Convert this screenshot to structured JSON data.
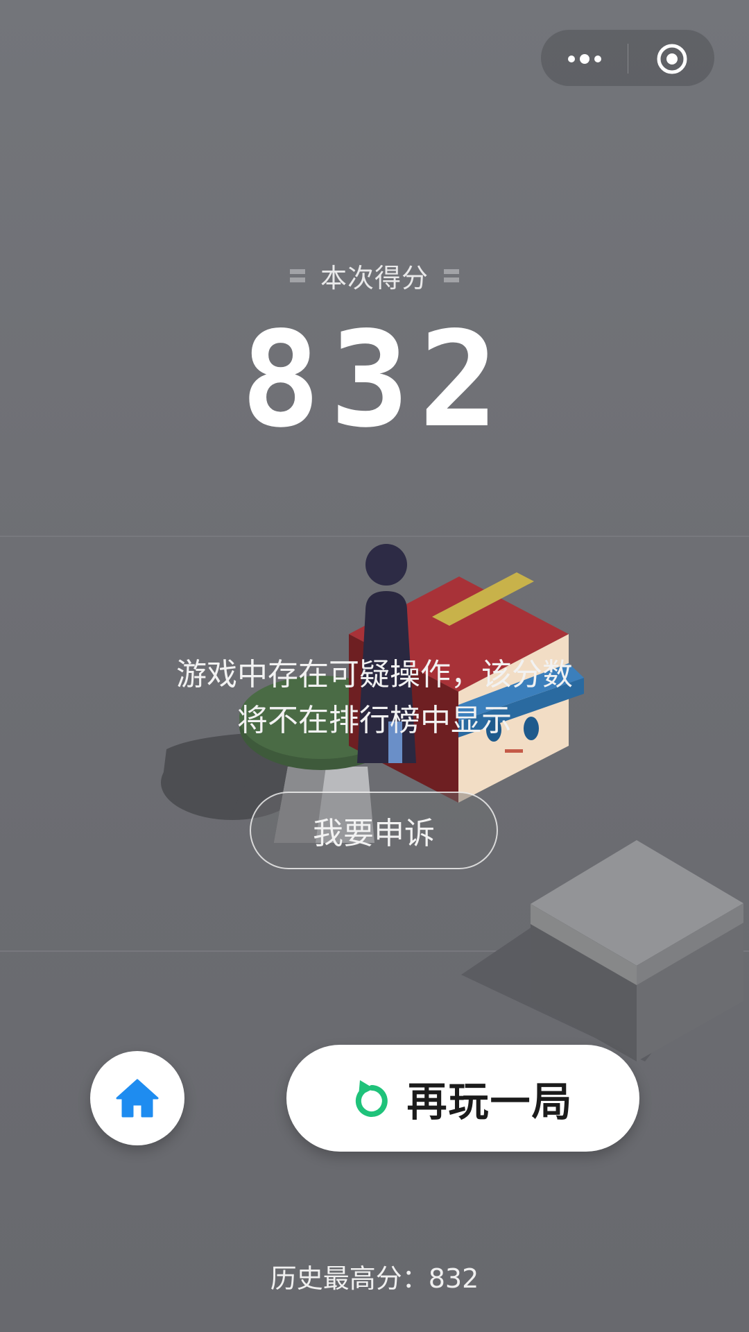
{
  "capsule": {
    "more_icon": "more-dots-icon",
    "close_icon": "target-close-icon"
  },
  "score": {
    "label": "本次得分",
    "value": "832"
  },
  "warning": {
    "line1": "游戏中存在可疑操作，该分数",
    "line2": "将不在排行榜中显示"
  },
  "appeal_button": {
    "label": "我要申诉"
  },
  "actions": {
    "home_icon": "home-icon",
    "replay_icon": "replay-icon",
    "replay_label": "再玩一局"
  },
  "best_score": {
    "text": "历史最高分：832"
  },
  "colors": {
    "background": "#6e6f74",
    "home_icon": "#1e8cf0",
    "replay_icon": "#1fc27a",
    "button_bg": "#ffffff"
  }
}
